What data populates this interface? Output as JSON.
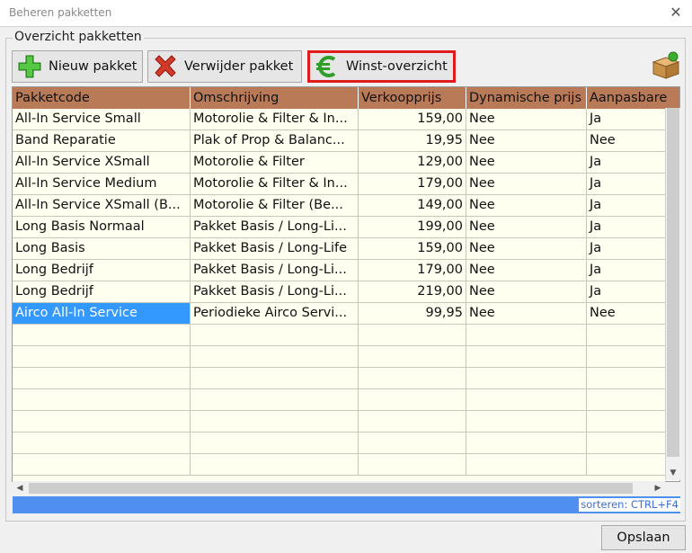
{
  "window": {
    "title": "Beheren pakketten",
    "close_glyph": "✕"
  },
  "group": {
    "title": "Overzicht pakketten"
  },
  "toolbar": {
    "new_label": "Nieuw pakket",
    "delete_label": "Verwijder pakket",
    "winst_label": "Winst-overzicht",
    "icons": {
      "new": "plus-icon",
      "delete": "delete-x-icon",
      "winst": "euro-icon",
      "package": "package-box-icon"
    }
  },
  "table": {
    "columns": [
      "Pakketcode",
      "Omschrijving",
      "Verkoopprijs",
      "Dynamische prijs",
      "Aanpasbare"
    ],
    "rows": [
      [
        "All-In Service Small",
        "Motorolie & Filter & In...",
        "159,00",
        "Nee",
        "Ja"
      ],
      [
        "Band Reparatie",
        "Plak of Prop & Balanc...",
        "19,95",
        "Nee",
        "Nee"
      ],
      [
        "All-In Service XSmall",
        "Motorolie & Filter",
        "129,00",
        "Nee",
        "Ja"
      ],
      [
        "All-In Service Medium",
        "Motorolie & Filter & In...",
        "179,00",
        "Nee",
        "Ja"
      ],
      [
        "All-In Service XSmall (B...",
        "Motorolie & Filter (Be...",
        "149,00",
        "Nee",
        "Ja"
      ],
      [
        "Long  Basis  Normaal",
        "Pakket Basis / Long-Li...",
        "199,00",
        "Nee",
        "Ja"
      ],
      [
        "Long Basis",
        "Pakket Basis / Long-Life",
        "159,00",
        "Nee",
        "Ja"
      ],
      [
        "Long Bedrijf",
        "Pakket Basis / Long-Li...",
        "179,00",
        "Nee",
        "Ja"
      ],
      [
        "Long Bedrijf",
        "Pakket Basis / Long-Li...",
        "219,00",
        "Nee",
        "Ja"
      ],
      [
        "Airco All-In Service",
        "Periodieke Airco Servi...",
        "99,95",
        "Nee",
        "Nee"
      ]
    ],
    "selected_row": 9,
    "empty_rows": 7
  },
  "status": {
    "hint": "sorteren: CTRL+F4"
  },
  "footer": {
    "save_label": "Opslaan"
  },
  "colors": {
    "header_bg": "#b97a58",
    "grid_bg": "#fffff0",
    "selection": "#3399ff",
    "status_bar": "#4f8ff0",
    "highlight_border": "#e01b1b"
  }
}
